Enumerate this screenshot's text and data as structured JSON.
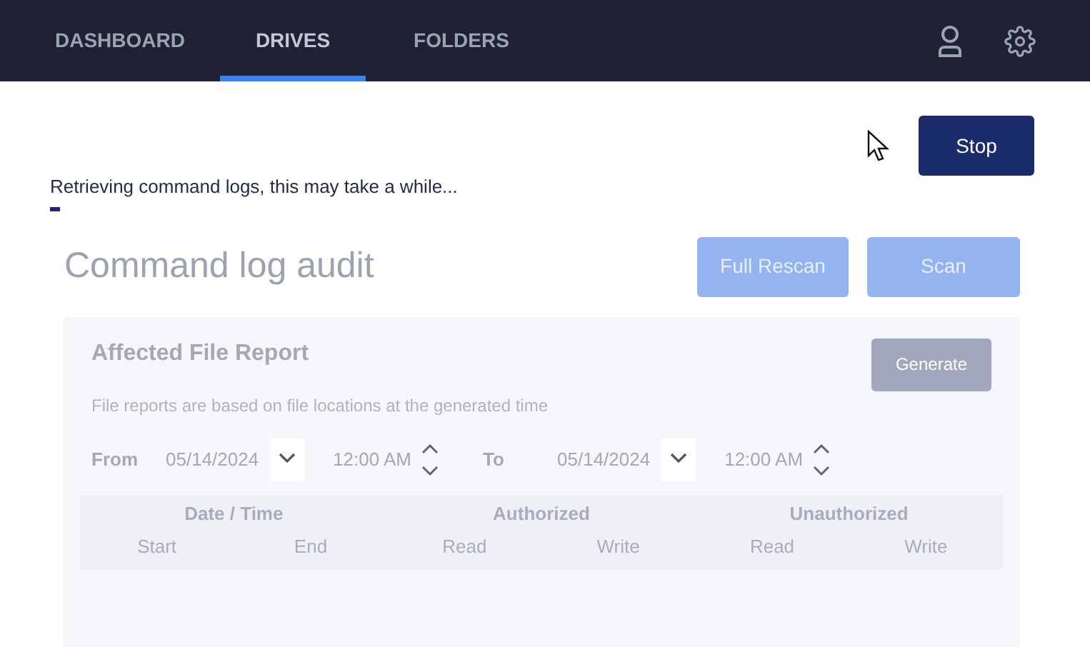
{
  "nav": {
    "tabs": [
      {
        "label": "DASHBOARD",
        "selected": false
      },
      {
        "label": "DRIVES",
        "selected": true
      },
      {
        "label": "FOLDERS",
        "selected": false
      }
    ]
  },
  "stop_button": {
    "label": "Stop",
    "disabled": false
  },
  "status": {
    "message": "Retrieving command logs, this may take a while...",
    "level": 0.01
  },
  "title": "Command log audit",
  "actions": [
    {
      "label": "Full Rescan",
      "disabled": true
    },
    {
      "label": "Scan",
      "disabled": true
    }
  ],
  "report": {
    "title": "Affected File Report",
    "description": "File reports are based on file locations at the generated time",
    "generate_button": {
      "label": "Generate",
      "disabled": true
    },
    "from": {
      "label": "From",
      "date": "05/14/2024",
      "time": "12:00 AM"
    },
    "to": {
      "label": "To",
      "date": "05/14/2024",
      "time": "12:00 AM"
    },
    "table": {
      "groups": [
        "Date / Time",
        "Authorized",
        "Unauthorized"
      ],
      "columns": [
        "Start",
        "End",
        "Read",
        "Write",
        "Read",
        "Write"
      ]
    }
  }
}
